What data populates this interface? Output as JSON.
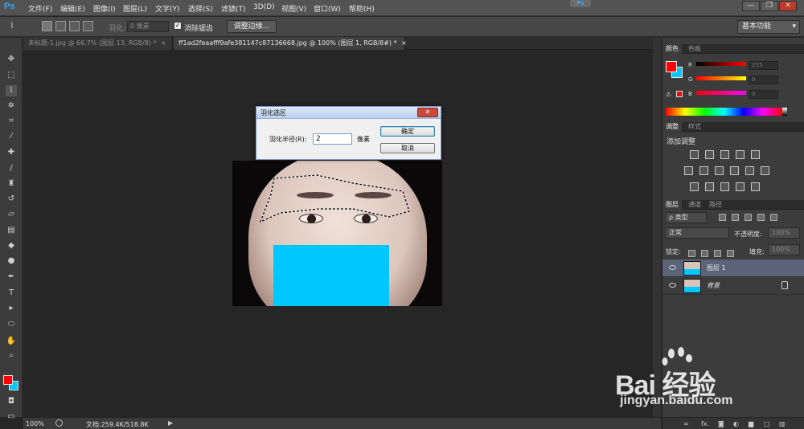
{
  "app": {
    "logo": "Ps",
    "center_badge": "Ps"
  },
  "menu": [
    "文件(F)",
    "编辑(E)",
    "图像(I)",
    "图层(L)",
    "文字(Y)",
    "选择(S)",
    "滤镜(T)",
    "3D(D)",
    "视图(V)",
    "窗口(W)",
    "帮助(H)"
  ],
  "window_controls": {
    "minimize": "—",
    "restore": "❐",
    "close": "✕"
  },
  "options_bar": {
    "feather_label": "羽化:",
    "feather_value": "0 像素",
    "antialias_label": "消除锯齿",
    "antialias_checked": "✓",
    "refine_edge": "调整边缘...",
    "workspace": "基本功能",
    "workspace_arrow": "▾"
  },
  "tabs": [
    {
      "label": "未标题-1.jpg @ 66.7% (图层 13, RGB/8) *",
      "close": "×"
    },
    {
      "label": "ff1ad2feaafff9afe381147c87136668.jpg @ 100% (图层 1, RGB/8#) *",
      "close": "×"
    }
  ],
  "dialog": {
    "title": "羽化选区",
    "close": "✕",
    "radius_label": "羽化半径(R):",
    "radius_value": "2",
    "unit": "像素",
    "ok": "确定",
    "cancel": "取消"
  },
  "status": {
    "zoom": "100%",
    "doc": "文档:259.4K/518.8K",
    "arrow": "▶"
  },
  "color_panel": {
    "tabs": [
      "颜色",
      "色板"
    ],
    "r_label": "R",
    "r_value": "255",
    "g_label": "G",
    "g_value": "0",
    "b_label": "B",
    "b_value": "0",
    "fg_color": "#ff0000",
    "bg_color": "#00c8ff"
  },
  "adjustments_panel": {
    "tabs": [
      "调整",
      "样式"
    ],
    "title": "添加调整"
  },
  "layers_panel": {
    "tabs": [
      "图层",
      "通道",
      "路径"
    ],
    "filter_kind": "ρ 类型",
    "blend_mode": "正常",
    "opacity_label": "不透明度:",
    "opacity_value": "100%",
    "lock_label": "锁定:",
    "fill_label": "填充:",
    "fill_value": "100%",
    "layers": [
      {
        "name": "图层 1",
        "selected": true
      },
      {
        "name": "背景",
        "locked": true
      }
    ],
    "footer_fx": "fx."
  },
  "watermark": {
    "brand": "Bai 经验",
    "url": "jingyan.baidu.com"
  }
}
